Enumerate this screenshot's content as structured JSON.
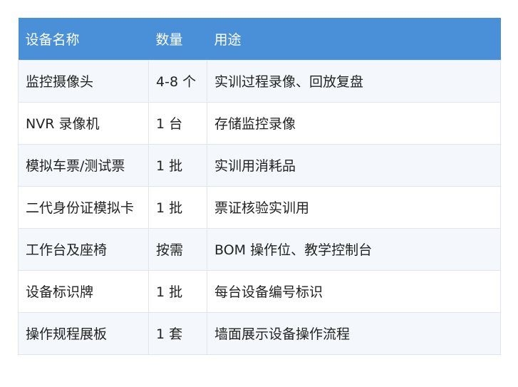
{
  "table": {
    "headers": [
      "设备名称",
      "数量",
      "用途"
    ],
    "rows": [
      [
        "监控摄像头",
        "4-8 个",
        "实训过程录像、回放复盘"
      ],
      [
        "NVR 录像机",
        "1 台",
        "存储监控录像"
      ],
      [
        "模拟车票/测试票",
        "1 批",
        "实训用消耗品"
      ],
      [
        "二代身份证模拟卡",
        "1 批",
        "票证核验实训用"
      ],
      [
        "工作台及座椅",
        "按需",
        "BOM 操作位、教学控制台"
      ],
      [
        "设备标识牌",
        "1 批",
        "每台设备编号标识"
      ],
      [
        "操作规程展板",
        "1 套",
        "墙面展示设备操作流程"
      ]
    ]
  },
  "colors": {
    "header_bg": "#4a90d9",
    "header_text": "#ffffff",
    "row_alt_bg": "#f4f8fc",
    "border": "#dfe6ee"
  }
}
